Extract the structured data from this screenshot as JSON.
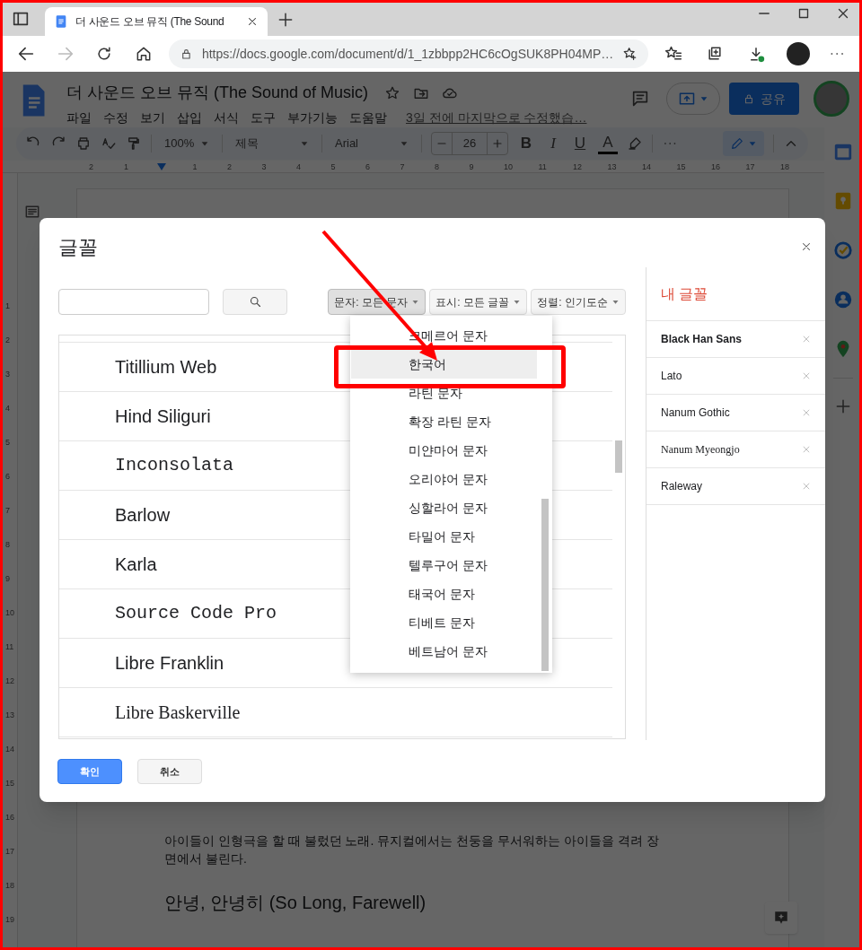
{
  "browser": {
    "tab_title": "더 사운드 오브 뮤직 (The Sound",
    "url": "https://docs.google.com/document/d/1_1zbbpp2HC6cOgSUK8PH04MP…"
  },
  "docs": {
    "title": "더 사운드 오브 뮤직 (The Sound of Music)",
    "menus": [
      "파일",
      "수정",
      "보기",
      "삽입",
      "서식",
      "도구",
      "부가기능",
      "도움말"
    ],
    "last_edit": "3일 전에 마지막으로 수정했습…",
    "share": "공유",
    "toolbar": {
      "zoom": "100%",
      "style": "제목",
      "font": "Arial",
      "size": "26",
      "bold_key": "B",
      "italic_key": "I",
      "underline_key": "U",
      "color_key": "A"
    },
    "ruler": [
      "2",
      "1",
      "1",
      "2",
      "3",
      "4",
      "5",
      "6",
      "7",
      "8",
      "9",
      "10",
      "11",
      "12",
      "13",
      "14",
      "15",
      "16",
      "17",
      "18"
    ],
    "vertical_ruler": [
      "1",
      "2",
      "3",
      "4",
      "5",
      "6",
      "7",
      "8",
      "9",
      "10",
      "11",
      "12",
      "13",
      "14",
      "15",
      "16",
      "17",
      "18",
      "19"
    ],
    "body": [
      {
        "kind": "paragraph",
        "text": "아이들이 인형극을 할 때 불렀던 노래. 뮤지컬에서는 천둥을 무서워하는 아이들을 격려 장면에서 불린다."
      },
      {
        "kind": "heading",
        "text": "안녕, 안녕히 (So Long, Farewell)"
      }
    ]
  },
  "dialog": {
    "title": "글꼴",
    "filters": [
      {
        "label": "문자: 모든 문자",
        "open": true
      },
      {
        "label": "표시: 모든 글꼴",
        "open": false
      },
      {
        "label": "정렬: 인기도순",
        "open": false
      }
    ],
    "fonts": [
      {
        "name": "Titillium Web",
        "kind": "sans"
      },
      {
        "name": "Hind Siliguri",
        "kind": "sans"
      },
      {
        "name": "Inconsolata",
        "kind": "mono"
      },
      {
        "name": "Barlow",
        "kind": "sans"
      },
      {
        "name": "Karla",
        "kind": "sans"
      },
      {
        "name": "Source Code Pro",
        "kind": "mono"
      },
      {
        "name": "Libre Franklin",
        "kind": "sans"
      },
      {
        "name": "Libre Baskerville",
        "kind": "serif"
      }
    ],
    "my_fonts_title": "내 글꼴",
    "my_fonts": [
      {
        "name": "Black Han Sans",
        "kind": "bold"
      },
      {
        "name": "Lato",
        "kind": "sans"
      },
      {
        "name": "Nanum Gothic",
        "kind": "sans"
      },
      {
        "name": "Nanum Myeongjo",
        "kind": "serif"
      },
      {
        "name": "Raleway",
        "kind": "sans"
      }
    ],
    "ok": "확인",
    "cancel": "취소",
    "dropdown": [
      {
        "label": "크메르어 문자",
        "selected": false
      },
      {
        "label": "한국어",
        "selected": true
      },
      {
        "label": "라틴 문자",
        "selected": false
      },
      {
        "label": "확장 라틴 문자",
        "selected": false
      },
      {
        "label": "미얀마어 문자",
        "selected": false
      },
      {
        "label": "오리야어 문자",
        "selected": false
      },
      {
        "label": "싱할라어 문자",
        "selected": false
      },
      {
        "label": "타밀어 문자",
        "selected": false
      },
      {
        "label": "텔루구어 문자",
        "selected": false
      },
      {
        "label": "태국어 문자",
        "selected": false
      },
      {
        "label": "티베트 문자",
        "selected": false
      },
      {
        "label": "베트남어 문자",
        "selected": false
      }
    ]
  }
}
